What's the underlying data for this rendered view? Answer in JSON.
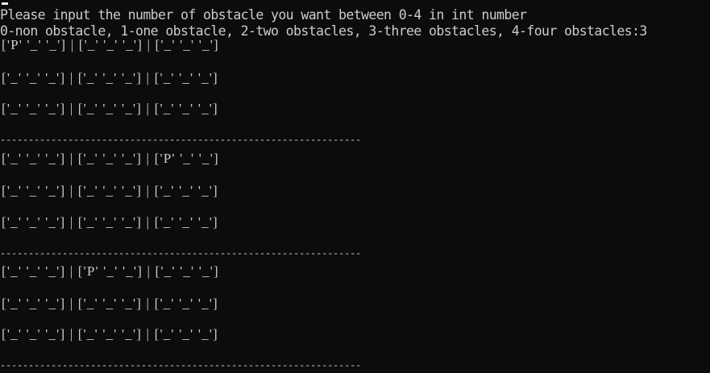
{
  "prompt": {
    "line1": "Please input the number of obstacle you want between 0-4 in int number",
    "line2": "0-non obstacle, 1-one obstacle, 2-two obstacles, 3-three obstacles, 4-four obstacles:3"
  },
  "board": {
    "rows": [
      "['P' '_' '_'] | ['_' '_' '_'] | ['_' '_' '_']",
      "['_' '_' '_'] | ['_' '_' '_'] | ['_' '_' '_']",
      "['_' '_' '_'] | ['_' '_' '_'] | ['_' '_' '_']",
      "['_' '_' '_'] | ['_' '_' '_'] | ['P' '_' '_']",
      "['_' '_' '_'] | ['_' '_' '_'] | ['_' '_' '_']",
      "['_' '_' '_'] | ['_' '_' '_'] | ['_' '_' '_']",
      "['_' '_' '_'] | ['P' '_' '_'] | ['_' '_' '_']",
      "['_' '_' '_'] | ['_' '_' '_'] | ['_' '_' '_']",
      "['_' '_' '_'] | ['_' '_' '_'] | ['_' '_' '_']"
    ],
    "separator": "----------------------------------------------------------------"
  },
  "colors": {
    "background": "#0c0c0c",
    "text": "#cccccc"
  }
}
